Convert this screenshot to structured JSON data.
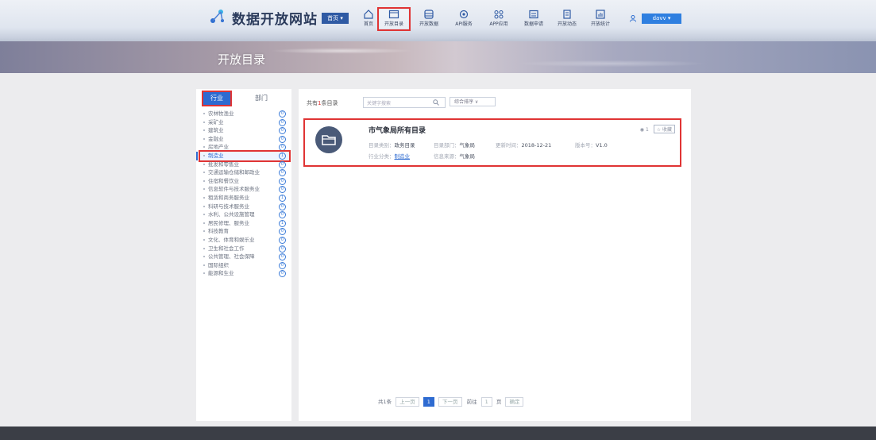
{
  "header": {
    "site_title": "数据开放网站",
    "city_select": "首页 ▾",
    "nav": [
      {
        "label": "首页",
        "icon": "home-icon"
      },
      {
        "label": "开放目录",
        "icon": "catalog-icon",
        "active": true
      },
      {
        "label": "开放数据",
        "icon": "database-icon"
      },
      {
        "label": "API服务",
        "icon": "api-icon"
      },
      {
        "label": "APP应用",
        "icon": "apps-icon"
      },
      {
        "label": "数据申请",
        "icon": "apply-icon"
      },
      {
        "label": "开放动态",
        "icon": "news-icon"
      },
      {
        "label": "开放统计",
        "icon": "stats-icon"
      }
    ],
    "user_button": "davv ▾",
    "page_title": "开放目录"
  },
  "sidebar": {
    "tabs": [
      {
        "label": "行业",
        "active": true
      },
      {
        "label": "部门",
        "active": false
      }
    ],
    "items": [
      {
        "label": "农林牧渔业",
        "count": "0"
      },
      {
        "label": "采矿业",
        "count": "0"
      },
      {
        "label": "建筑业",
        "count": "0"
      },
      {
        "label": "金融业",
        "count": "0"
      },
      {
        "label": "房地产业",
        "count": "0"
      },
      {
        "label": "制造业",
        "count": "1",
        "active": true
      },
      {
        "label": "批发和零售业",
        "count": "0"
      },
      {
        "label": "交通运输仓储和邮政业",
        "count": "0"
      },
      {
        "label": "住宿和餐饮业",
        "count": "0"
      },
      {
        "label": "信息软件与技术服务业",
        "count": "0"
      },
      {
        "label": "租赁和商务服务业",
        "count": "1"
      },
      {
        "label": "科研与技术服务业",
        "count": "0"
      },
      {
        "label": "水利、公共设施管理",
        "count": "0"
      },
      {
        "label": "居民修理、服务业",
        "count": "1"
      },
      {
        "label": "科技教育",
        "count": "0"
      },
      {
        "label": "文化、体育和娱乐业",
        "count": "0"
      },
      {
        "label": "卫生和社会工作",
        "count": "0"
      },
      {
        "label": "公共管理、社会保障",
        "count": "0"
      },
      {
        "label": "国际组织",
        "count": "0"
      },
      {
        "label": "能源和生业",
        "count": "0"
      }
    ]
  },
  "main": {
    "total_prefix": "共有",
    "total_count": "1",
    "total_suffix": "条目录",
    "search_placeholder": "关键字搜索",
    "sort_label": "综合排序 ∨",
    "card": {
      "title": "市气象局所有目录",
      "type_label": "目录类别：",
      "type_value": "政务目录",
      "dept_label": "目录部门：",
      "dept_value": "气象局",
      "date_label": "更新时间：",
      "date_value": "2018-12-21",
      "version_label": "版本号：",
      "version_value": "V1.0",
      "industry_label": "行业分类：",
      "industry_value": "制造业",
      "source_label": "信息来源：",
      "source_value": "气象局",
      "views": "1",
      "fav_label": "☆ 收藏"
    },
    "pager": {
      "total": "共1条",
      "prev": "上一页",
      "current": "1",
      "next": "下一页",
      "goto_label": "前往",
      "goto_value": "1",
      "page_unit": "页",
      "confirm": "确定"
    }
  }
}
